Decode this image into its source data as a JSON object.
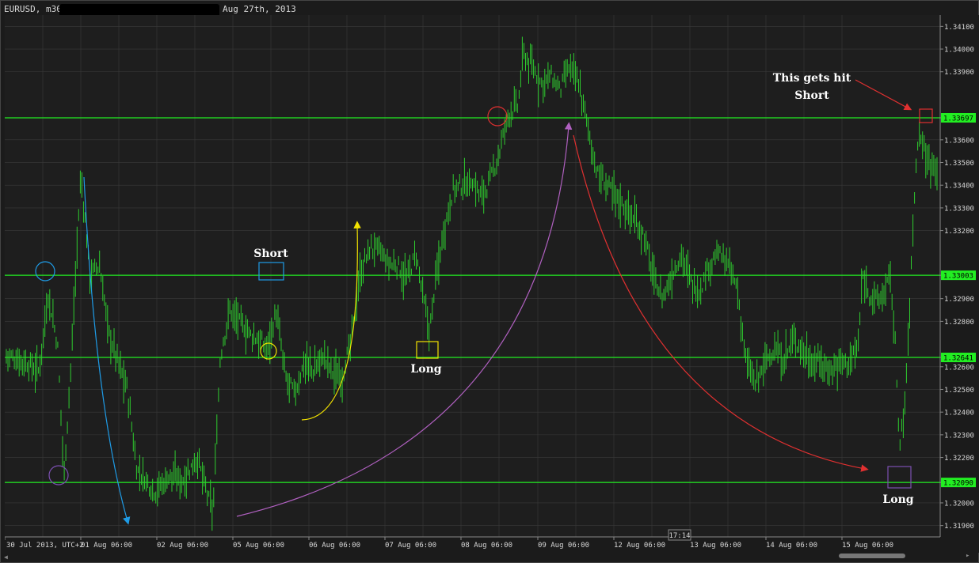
{
  "header": {
    "symbol": "EURUSD, m30",
    "date": "Aug 27th, 2013"
  },
  "cursor_time": "17:14",
  "colors": {
    "background": "#1e1e1e",
    "grid": "#3a3a3a",
    "candle": "#2ecc2e",
    "level_line": "#22ee22",
    "blue": "#1e9be6",
    "purple": "#9b59b6",
    "yellow": "#f2e200",
    "red": "#e03030",
    "magenta": "#c060c0"
  },
  "chart_data": {
    "type": "bar",
    "symbol": "EURUSD",
    "timeframe": "m30",
    "y_tick_labels": [
      "1.34100",
      "1.34000",
      "1.33900",
      "1.33697",
      "1.33600",
      "1.33500",
      "1.33400",
      "1.33300",
      "1.33200",
      "1.33003",
      "1.32900",
      "1.32800",
      "1.32641",
      "1.32600",
      "1.32500",
      "1.32400",
      "1.32300",
      "1.32200",
      "1.32090",
      "1.32000",
      "1.31900"
    ],
    "ylim": [
      1.3185,
      1.3415
    ],
    "x_tick_labels": [
      "30 Jul 2013, UTC+2",
      "01 Aug 06:00",
      "02 Aug 06:00",
      "05 Aug 06:00",
      "06 Aug 06:00",
      "07 Aug 06:00",
      "08 Aug 06:00",
      "09 Aug 06:00",
      "12 Aug 06:00",
      "13 Aug 06:00",
      "14 Aug 06:00",
      "15 Aug 06:00"
    ],
    "horizontal_levels": [
      1.33697,
      1.33003,
      1.32641,
      1.3209
    ],
    "price_path": [
      [
        0,
        1.3265
      ],
      [
        0.02,
        1.3262
      ],
      [
        0.035,
        1.3258
      ],
      [
        0.045,
        1.3292
      ],
      [
        0.055,
        1.327
      ],
      [
        0.062,
        1.3212
      ],
      [
        0.07,
        1.3265
      ],
      [
        0.08,
        1.3345
      ],
      [
        0.09,
        1.33
      ],
      [
        0.1,
        1.3305
      ],
      [
        0.11,
        1.3275
      ],
      [
        0.12,
        1.3262
      ],
      [
        0.13,
        1.325
      ],
      [
        0.14,
        1.3215
      ],
      [
        0.15,
        1.321
      ],
      [
        0.16,
        1.3205
      ],
      [
        0.175,
        1.3212
      ],
      [
        0.19,
        1.321
      ],
      [
        0.205,
        1.322
      ],
      [
        0.215,
        1.3205
      ],
      [
        0.222,
        1.3195
      ],
      [
        0.23,
        1.3265
      ],
      [
        0.24,
        1.3285
      ],
      [
        0.25,
        1.328
      ],
      [
        0.26,
        1.3275
      ],
      [
        0.27,
        1.3272
      ],
      [
        0.28,
        1.3268
      ],
      [
        0.29,
        1.3284
      ],
      [
        0.3,
        1.3255
      ],
      [
        0.31,
        1.3248
      ],
      [
        0.32,
        1.3262
      ],
      [
        0.33,
        1.3258
      ],
      [
        0.34,
        1.3265
      ],
      [
        0.35,
        1.3258
      ],
      [
        0.36,
        1.3255
      ],
      [
        0.37,
        1.327
      ],
      [
        0.38,
        1.33
      ],
      [
        0.39,
        1.3312
      ],
      [
        0.4,
        1.3312
      ],
      [
        0.41,
        1.3305
      ],
      [
        0.42,
        1.3305
      ],
      [
        0.43,
        1.3298
      ],
      [
        0.44,
        1.331
      ],
      [
        0.45,
        1.3285
      ],
      [
        0.455,
        1.3275
      ],
      [
        0.46,
        1.3295
      ],
      [
        0.47,
        1.332
      ],
      [
        0.48,
        1.3338
      ],
      [
        0.49,
        1.334
      ],
      [
        0.5,
        1.3342
      ],
      [
        0.51,
        1.3335
      ],
      [
        0.52,
        1.3342
      ],
      [
        0.53,
        1.3355
      ],
      [
        0.54,
        1.3372
      ],
      [
        0.55,
        1.3375
      ],
      [
        0.555,
        1.3398
      ],
      [
        0.565,
        1.3392
      ],
      [
        0.575,
        1.3385
      ],
      [
        0.585,
        1.3388
      ],
      [
        0.595,
        1.3382
      ],
      [
        0.605,
        1.3392
      ],
      [
        0.615,
        1.3385
      ],
      [
        0.625,
        1.3365
      ],
      [
        0.635,
        1.3345
      ],
      [
        0.645,
        1.334
      ],
      [
        0.655,
        1.3335
      ],
      [
        0.665,
        1.333
      ],
      [
        0.675,
        1.3325
      ],
      [
        0.685,
        1.3318
      ],
      [
        0.695,
        1.33
      ],
      [
        0.705,
        1.329
      ],
      [
        0.715,
        1.33
      ],
      [
        0.725,
        1.331
      ],
      [
        0.735,
        1.3298
      ],
      [
        0.745,
        1.3293
      ],
      [
        0.755,
        1.3305
      ],
      [
        0.765,
        1.331
      ],
      [
        0.775,
        1.3305
      ],
      [
        0.785,
        1.3295
      ],
      [
        0.795,
        1.3262
      ],
      [
        0.805,
        1.3252
      ],
      [
        0.815,
        1.3262
      ],
      [
        0.825,
        1.3268
      ],
      [
        0.835,
        1.3262
      ],
      [
        0.845,
        1.3272
      ],
      [
        0.855,
        1.3268
      ],
      [
        0.865,
        1.3262
      ],
      [
        0.875,
        1.3262
      ],
      [
        0.885,
        1.3258
      ],
      [
        0.895,
        1.3262
      ],
      [
        0.905,
        1.3262
      ],
      [
        0.915,
        1.3268
      ],
      [
        0.92,
        1.33
      ],
      [
        0.93,
        1.329
      ],
      [
        0.94,
        1.329
      ],
      [
        0.95,
        1.33
      ],
      [
        0.955,
        1.327
      ],
      [
        0.96,
        1.3225
      ],
      [
        0.965,
        1.324
      ],
      [
        0.97,
        1.328
      ],
      [
        0.975,
        1.333
      ],
      [
        0.98,
        1.3365
      ],
      [
        0.99,
        1.335
      ],
      [
        1.0,
        1.335
      ]
    ],
    "annotations": [
      "Short",
      "Long",
      "Long",
      "This gets hit",
      "Short"
    ]
  },
  "annotations": {
    "short_1": "Short",
    "long_1": "Long",
    "long_2": "Long",
    "hit_line1": "This gets hit",
    "hit_line2": "Short"
  }
}
